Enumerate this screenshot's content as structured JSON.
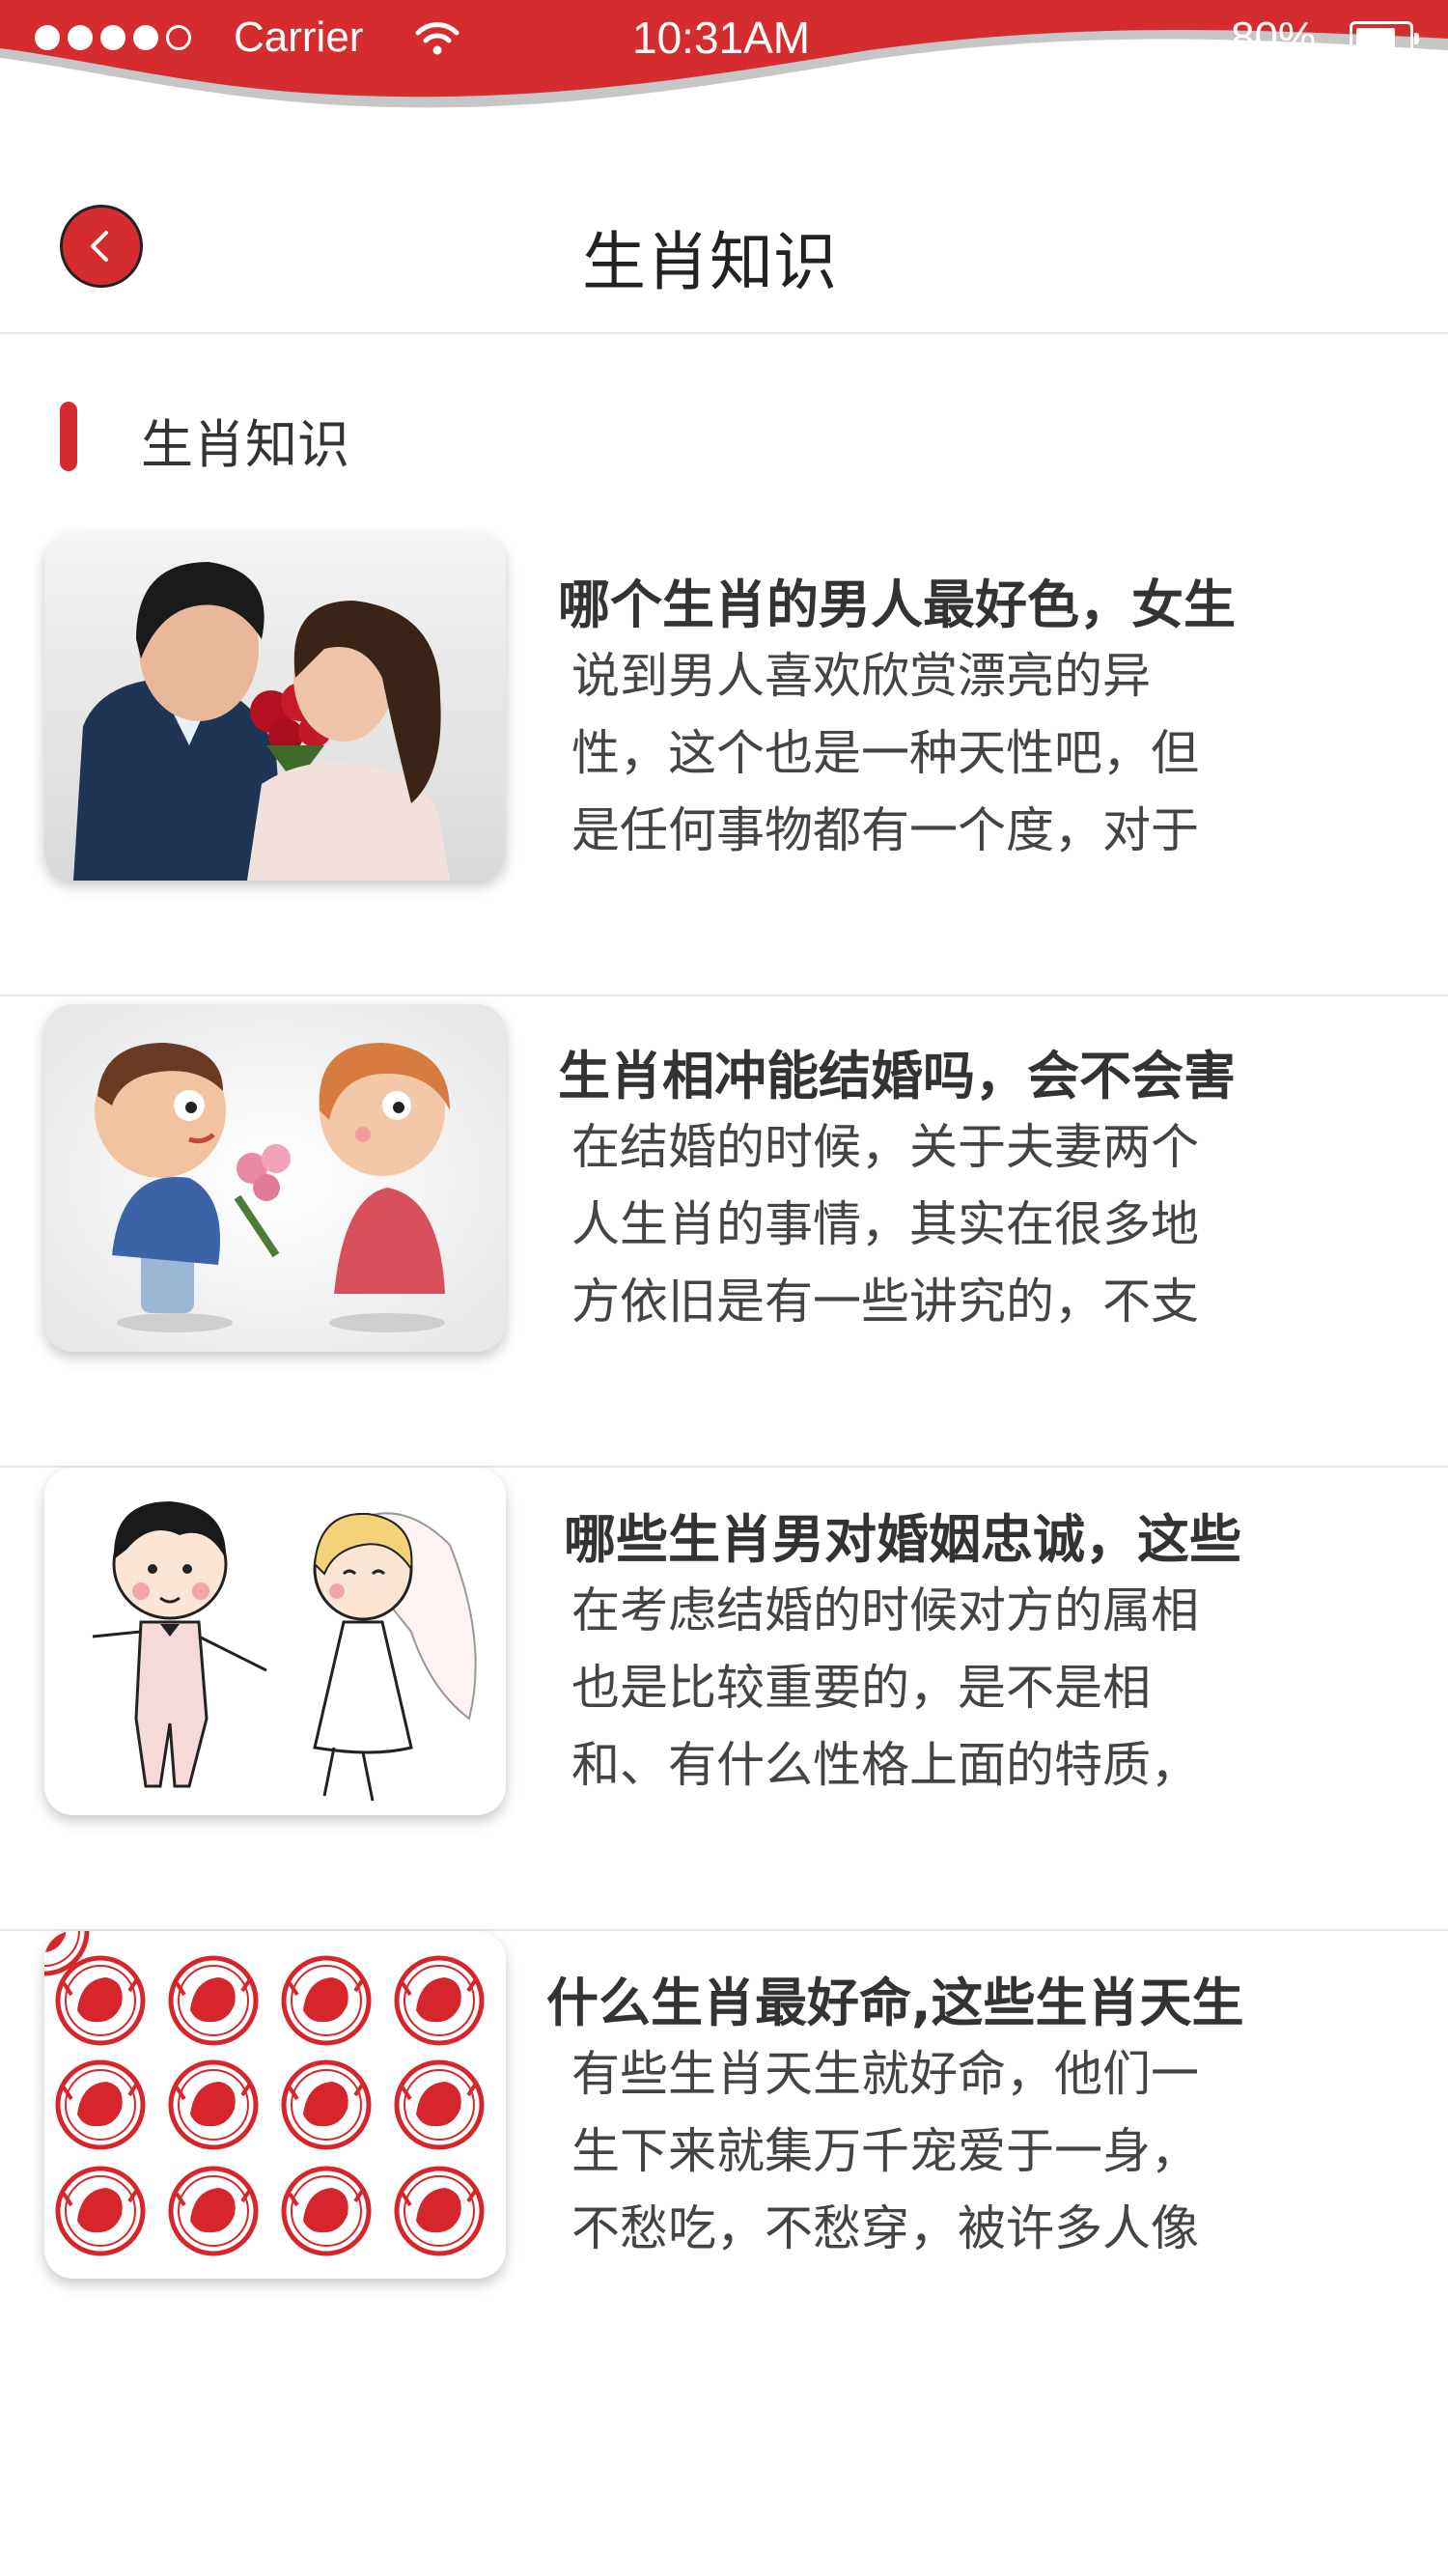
{
  "status_bar": {
    "carrier": "Carrier",
    "time": "10:31AM",
    "battery": "80%",
    "signal_filled": 4,
    "signal_total": 5,
    "wifi_icon": "wifi-icon",
    "battery_level": 0.8
  },
  "nav": {
    "title": "生肖知识",
    "back_icon": "chevron-left-icon"
  },
  "section": {
    "title": "生肖知识"
  },
  "articles": [
    {
      "title": "哪个生肖的男人最好色，女生",
      "summary": "说到男人喜欢欣赏漂亮的异性，这个也是一种天性吧，但是任何事物都有一个度，对于",
      "image": "couple-kissing-with-roses-photo"
    },
    {
      "title": "生肖相冲能结婚吗，会不会害",
      "summary": "在结婚的时候，关于夫妻两个人生肖的事情，其实在很多地方依旧是有一些讲究的，不支",
      "image": "clay-figurine-couple-with-flowers"
    },
    {
      "title": "哪些生肖男对婚姻忠诚，这些",
      "summary": "在考虑结婚的时候对方的属相也是比较重要的，是不是相和、有什么性格上面的特质，",
      "image": "cartoon-bride-and-groom"
    },
    {
      "title": "什么生肖最好命,这些生肖天生",
      "summary": "有些生肖天生就好命，他们一生下来就集万千宠爱于一身，不愁吃，不愁穿，被许多人像",
      "image": "twelve-zodiac-paper-cuts"
    }
  ],
  "colors": {
    "accent": "#d52d2f",
    "text": "#333333",
    "divider": "#e6e6e6"
  }
}
